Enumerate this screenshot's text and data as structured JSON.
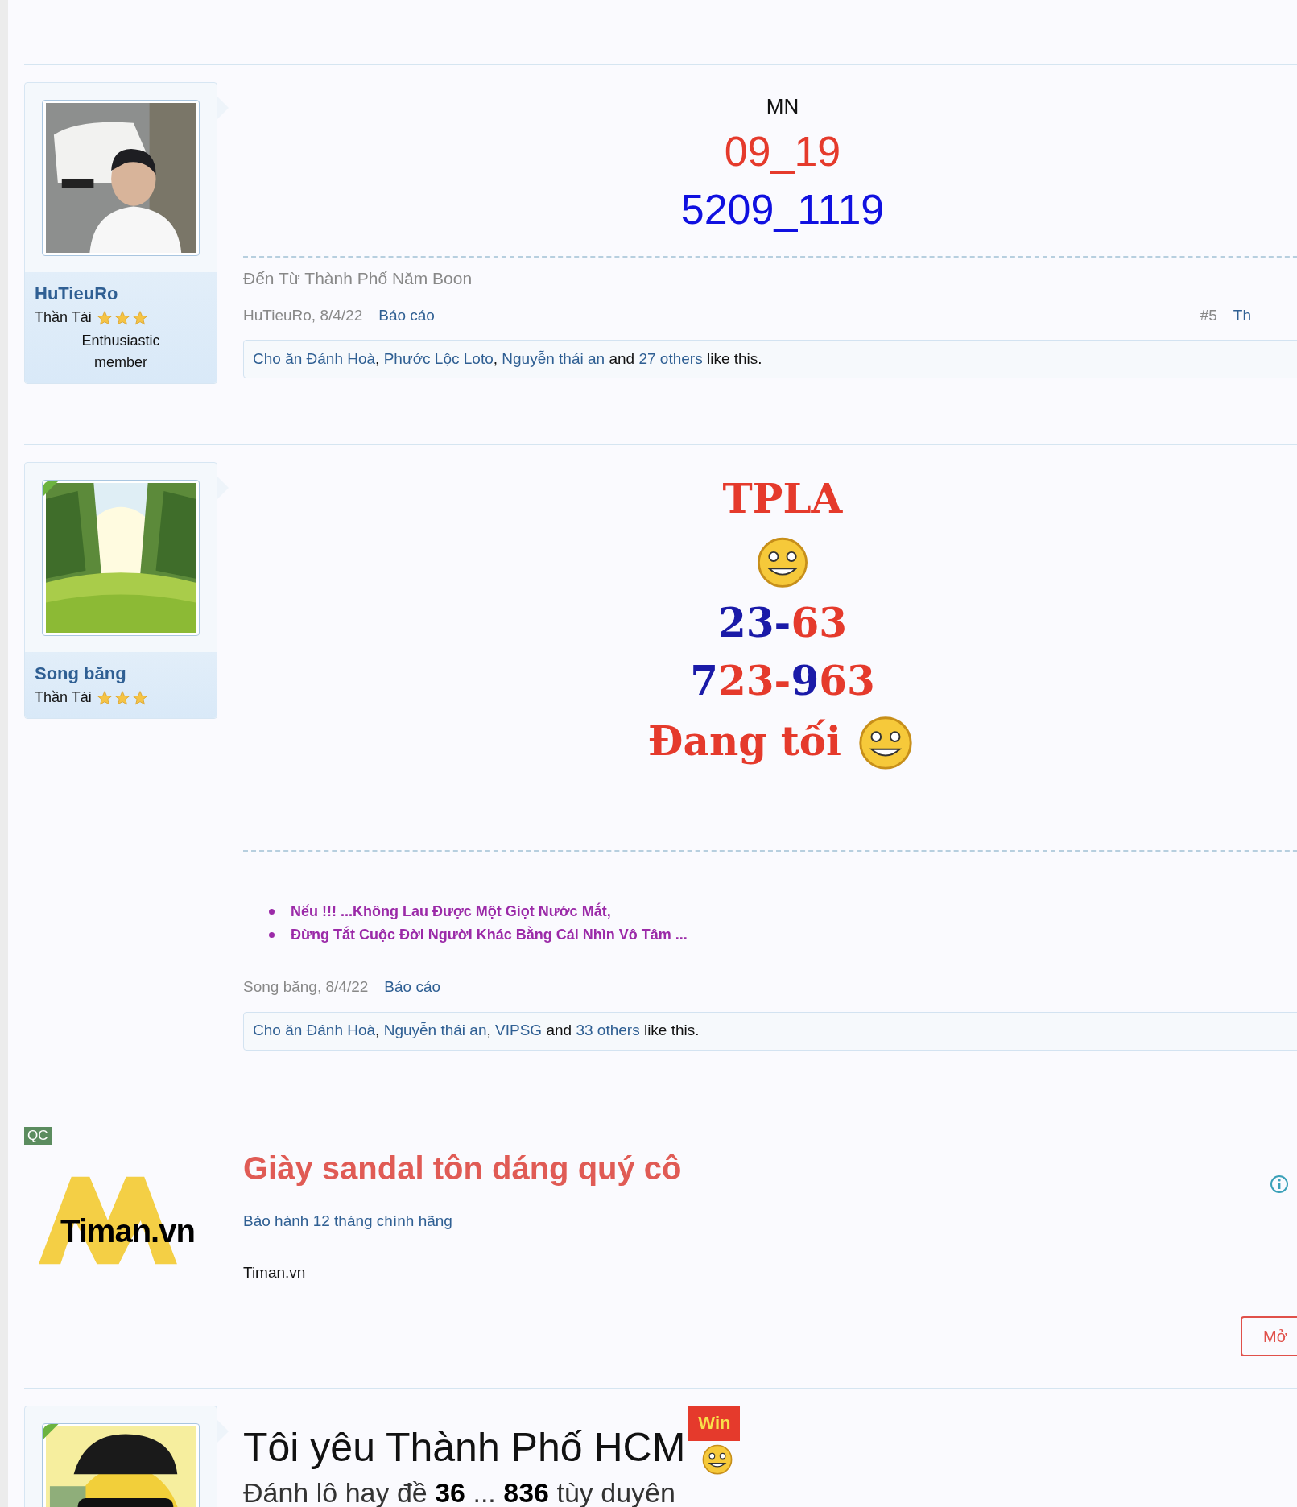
{
  "posts": [
    {
      "avatar": {
        "kind": "person"
      },
      "username": "HuTieuRo",
      "title": "Thần Tài",
      "stars": 3,
      "user_title": "Enthusiastic member",
      "corner": false,
      "content": [
        {
          "kind": "label",
          "segments": [
            {
              "text": "MN",
              "color": "#111111"
            }
          ]
        },
        {
          "kind": "numbers",
          "segments": [
            {
              "text": "09_19",
              "color": "#e53a2c"
            }
          ]
        },
        {
          "kind": "numbers",
          "segments": [
            {
              "text": "5209_1119",
              "color": "#1010e0"
            }
          ]
        }
      ],
      "signature": {
        "kind": "plain",
        "lines": [
          "Đến Từ Thành Phố Năm Boon"
        ]
      },
      "meta": {
        "author_date": "HuTieuRo, 8/4/22",
        "report": "Báo cáo",
        "number": "#5",
        "extra": "Th"
      },
      "likes": {
        "names": [
          "Cho ăn Đánh Hoà",
          "Phước Lộc Loto",
          "Nguyễn thái an"
        ],
        "separator": ",",
        "joiner": "and",
        "others": "27 others",
        "suffix": "like this."
      }
    },
    {
      "avatar": {
        "kind": "landscape"
      },
      "username": "Song băng",
      "title": "Thần Tài",
      "stars": 3,
      "corner": true,
      "content": [
        {
          "kind": "display",
          "segments": [
            {
              "text": "TPLA",
              "color": "#e53a2c"
            }
          ]
        },
        {
          "kind": "emoji"
        },
        {
          "kind": "display",
          "segments": [
            {
              "text": "23-",
              "color": "#1a1aa8"
            },
            {
              "text": "63",
              "color": "#e53a2c"
            }
          ]
        },
        {
          "kind": "display",
          "segments": [
            {
              "text": "7",
              "color": "#1a1aa8"
            },
            {
              "text": "23-",
              "color": "#e53a2c"
            },
            {
              "text": "9",
              "color": "#1a1aa8"
            },
            {
              "text": "63",
              "color": "#e53a2c"
            }
          ]
        },
        {
          "kind": "display_emoji",
          "segments": [
            {
              "text": "Đang tối",
              "color": "#e53a2c"
            }
          ]
        }
      ],
      "signature": {
        "kind": "bullets",
        "lines": [
          "Nếu !!! ...Không Lau Được Một Giọt Nước Mắt,",
          "Đừng Tắt Cuộc Đời Người Khác Bằng Cái Nhìn Vô Tâm ..."
        ]
      },
      "meta": {
        "author_date": "Song băng, 8/4/22",
        "report": "Báo cáo"
      },
      "likes": {
        "names": [
          "Cho ăn Đánh Hoà",
          "Nguyễn thái an",
          "VIPSG"
        ],
        "separator": ",",
        "joiner": "and",
        "others": "33 others",
        "suffix": "like this."
      }
    }
  ],
  "ad": {
    "badge": "QC",
    "logo": "Timan.vn",
    "title": "Giày sandal tôn dáng quý cô",
    "subtitle": "Bảo hành 12 tháng chính hãng",
    "site": "Timan.vn",
    "button": "Mở"
  },
  "last_post": {
    "avatar": {
      "kind": "cartoon"
    },
    "corner": true,
    "heading": "Tôi yêu Thành Phố HCM",
    "badge": "Win",
    "line": [
      {
        "text": "Đánh lô hay đề",
        "bold": false
      },
      {
        "text": "36",
        "bold": true
      },
      {
        "text": "...",
        "bold": false
      },
      {
        "text": "836",
        "bold": true
      },
      {
        "text": "tùy duyên",
        "bold": false
      }
    ]
  }
}
